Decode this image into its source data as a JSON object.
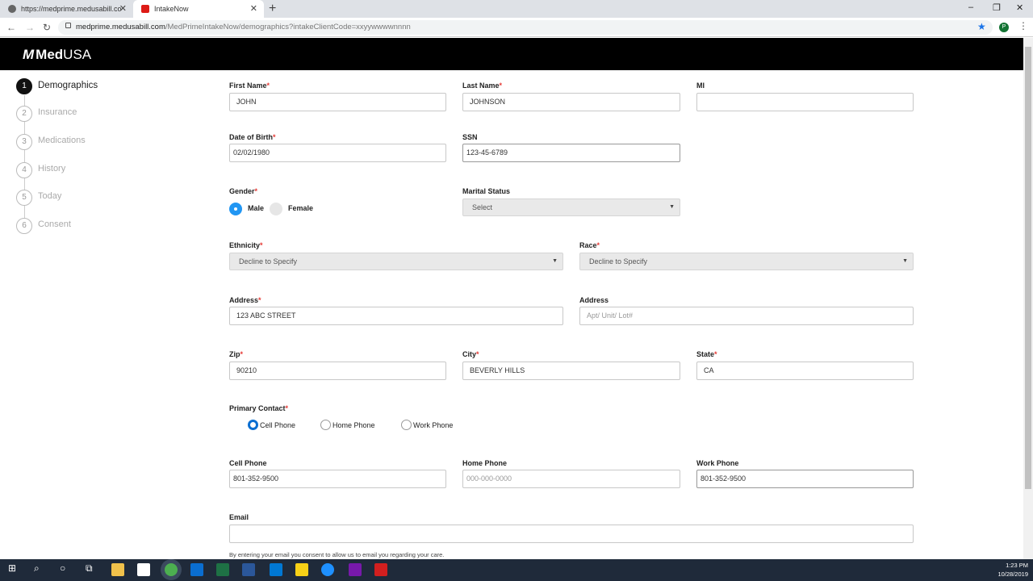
{
  "browser": {
    "tabs": [
      {
        "title": "https://medprime.medusabill.co",
        "close": "✕"
      },
      {
        "title": "IntakeNow",
        "close": "✕"
      }
    ],
    "new_tab": "+",
    "window_controls": [
      "–",
      "❐",
      "✕"
    ],
    "url_host": "medprime.medusabill.com",
    "url_path": "/MedPrimeIntakeNow/demographics?intakeClientCode=xxyywwwwnnnn",
    "profile_initial": "P"
  },
  "app": {
    "logo_mark": "M",
    "logo_text_bold": "Med",
    "logo_text": "USA"
  },
  "steps": [
    {
      "number": "1",
      "label": "Demographics"
    },
    {
      "number": "2",
      "label": "Insurance"
    },
    {
      "number": "3",
      "label": "Medications"
    },
    {
      "number": "4",
      "label": "History"
    },
    {
      "number": "5",
      "label": "Today"
    },
    {
      "number": "6",
      "label": "Consent"
    }
  ],
  "required_mark": "*",
  "form": {
    "first_name": {
      "label": "First Name",
      "value": "JOHN"
    },
    "last_name": {
      "label": "Last Name",
      "value": "JOHNSON"
    },
    "mi": {
      "label": "MI",
      "value": ""
    },
    "dob": {
      "label": "Date of Birth",
      "value": "02/02/1980"
    },
    "ssn": {
      "label": "SSN",
      "value": "123-45-6789"
    },
    "gender": {
      "label": "Gender",
      "options": [
        "Male",
        "Female"
      ],
      "selected": "Male"
    },
    "marital_status": {
      "label": "Marital Status",
      "value": "Select"
    },
    "ethnicity": {
      "label": "Ethnicity",
      "value": "Decline to Specify"
    },
    "race": {
      "label": "Race",
      "value": "Decline to Specify"
    },
    "address1": {
      "label": "Address",
      "value": "123 ABC STREET"
    },
    "address2": {
      "label": "Address",
      "placeholder": "Apt/ Unit/ Lot#"
    },
    "zip": {
      "label": "Zip",
      "value": "90210"
    },
    "city": {
      "label": "City",
      "value": "BEVERLY HILLS"
    },
    "state": {
      "label": "State",
      "value": "CA"
    },
    "primary_contact": {
      "label": "Primary Contact",
      "options": [
        "Cell Phone",
        "Home Phone",
        "Work Phone"
      ],
      "selected": "Cell Phone"
    },
    "cell_phone": {
      "label": "Cell Phone",
      "value": "801-352-9500"
    },
    "home_phone": {
      "label": "Home Phone",
      "placeholder": "000-000-0000"
    },
    "work_phone": {
      "label": "Work Phone",
      "value": "801-352-9500"
    },
    "email": {
      "label": "Email",
      "value": ""
    },
    "email_consent": "By entering your email you consent to allow us to email you regarding your care."
  },
  "taskbar": {
    "time": "1:23 PM",
    "date": "10/28/2019"
  },
  "colors": {
    "header_bg": "#000000",
    "accent_blue": "#2196f3",
    "required_red": "#e53935",
    "taskbar_bg": "#1f2a3a"
  }
}
